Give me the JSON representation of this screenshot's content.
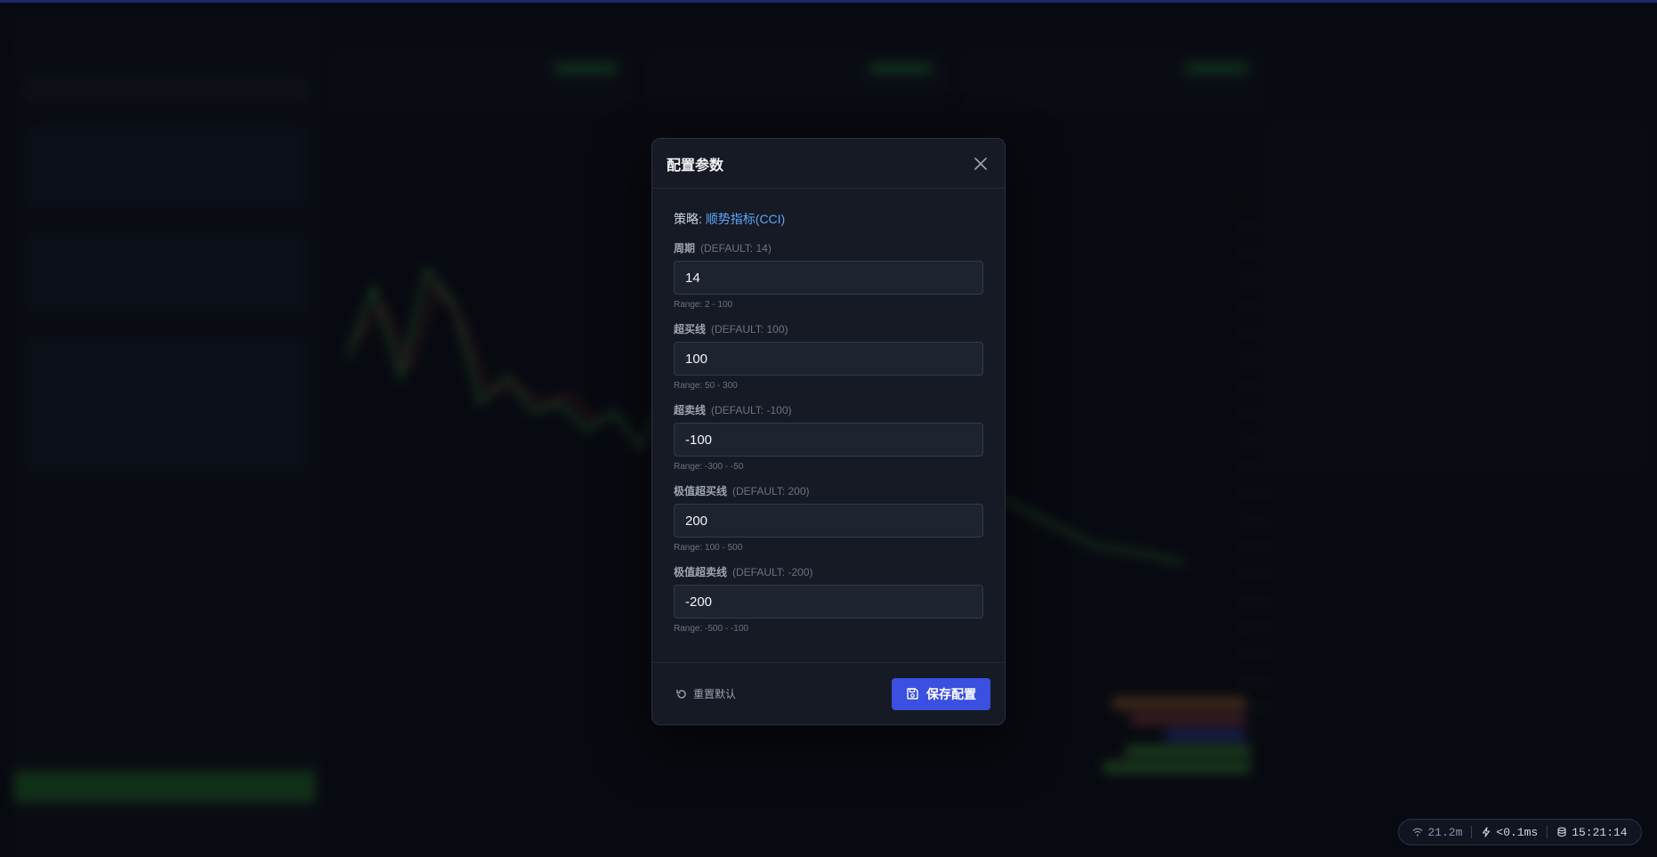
{
  "modal": {
    "title": "配置参数",
    "strategy_prefix": "策略:",
    "strategy_name": "顺势指标(CCI)",
    "fields": [
      {
        "label": "周期",
        "default": "(DEFAULT: 14)",
        "value": "14",
        "range": "Range: 2 - 100"
      },
      {
        "label": "超买线",
        "default": "(DEFAULT: 100)",
        "value": "100",
        "range": "Range: 50 - 300"
      },
      {
        "label": "超卖线",
        "default": "(DEFAULT: -100)",
        "value": "-100",
        "range": "Range: -300 - -50"
      },
      {
        "label": "极值超买线",
        "default": "(DEFAULT: 200)",
        "value": "200",
        "range": "Range: 100 - 500"
      },
      {
        "label": "极值超卖线",
        "default": "(DEFAULT: -200)",
        "value": "-200",
        "range": "Range: -500 - -100"
      }
    ],
    "reset_label": "重置默认",
    "save_label": "保存配置"
  },
  "statusbar": {
    "network": "21.2m",
    "latency": "<0.1ms",
    "time": "15:21:14"
  },
  "colors": {
    "accent": "#3b4fe0",
    "link": "#60a5fa"
  }
}
